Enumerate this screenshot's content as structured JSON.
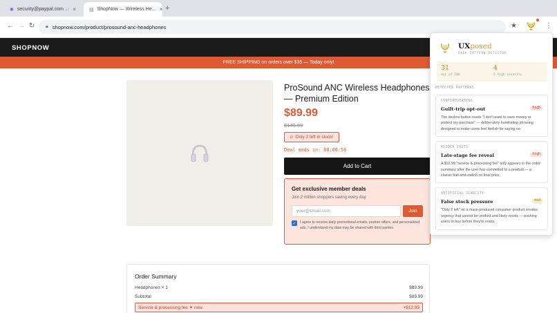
{
  "browser": {
    "tabs": [
      {
        "label": "security@paypal.com ...",
        "active": false
      },
      {
        "label": "ShopNow — Wireless He...",
        "active": true
      }
    ],
    "new_tab": "+",
    "url": "shopnow.com/product/prosound-anc-headphones"
  },
  "site": {
    "brand": "SHOPNOW",
    "promo": "FREE SHIPPING on orders over $35 — Today only!"
  },
  "product": {
    "title": "ProSound ANC Wireless Headphones — Premium Edition",
    "price": "$89.99",
    "old_price": "$149.99",
    "stock": "Only 2 left in stock!",
    "deal_prefix": "Deal ends in: ",
    "deal_timer": "00:00:58",
    "add_to_cart": "Add to Cart"
  },
  "member": {
    "title": "Get exclusive member deals",
    "subtitle": "Join 2 million shoppers saving every day",
    "email_placeholder": "your@email.com",
    "join": "Join",
    "consent": "I agree to receive daily promotional emails, partner offers, and personalized ads. I understand my data may be shared with third parties.",
    "consent_checked": true
  },
  "order": {
    "title": "Order Summary",
    "rows": [
      {
        "label": "Headphones × 1",
        "value": "$89.99"
      },
      {
        "label": "Subtotal",
        "value": "$89.99"
      },
      {
        "label": "Service & processing fee ✦ new",
        "value": "+$12.99"
      }
    ]
  },
  "extension": {
    "name_main": "UX",
    "name_accent": "posed",
    "subtitle": "DARK PATTERN DETECTOR",
    "score": "31",
    "score_label": "out of 100",
    "count": "4",
    "count_label": "2 high severity",
    "section_label": "DETECTED PATTERNS",
    "patterns": [
      {
        "category": "CONFIRMSHAMING",
        "name": "Guilt-trip opt-out",
        "severity": "high",
        "description": "The decline button reads \"I don't want to save money or protect my purchase\" — deliberately humiliating phrasing designed to make users feel foolish for saying no."
      },
      {
        "category": "HIDDEN COSTS",
        "name": "Late-stage fee reveal",
        "severity": "high",
        "description": "A $12.99 \"service & processing fee\" only appears in the order summary after the user has committed to a product — a classic bait-and-switch on final price."
      },
      {
        "category": "ARTIFICIAL SCARCITY",
        "name": "False stock pressure",
        "severity": "med",
        "description": "\"Only 2 left\" on a mass-produced consumer product creates urgency that cannot be verified and likely resets — pushing users to buy before they're ready."
      }
    ]
  },
  "colors": {
    "accent": "#de5a35",
    "gold": "#c9a227",
    "header": "#1b1b1b"
  }
}
